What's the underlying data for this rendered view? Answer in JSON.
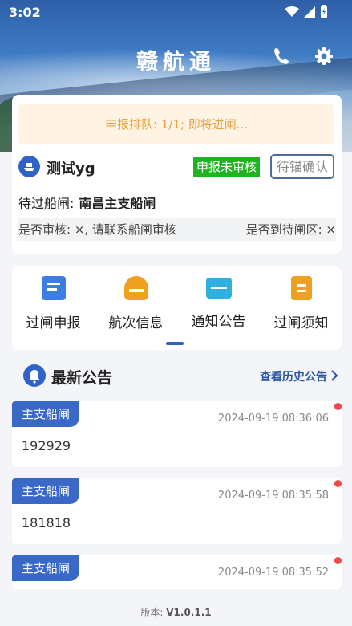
{
  "status_bar": {
    "time": "3:02"
  },
  "app": {
    "title": "赣航通"
  },
  "queue_notice": "申报排队: 1/1; 即将进闸...",
  "ship": {
    "name": "测试yg",
    "status_badge": "申报未审核",
    "anchor_badge": "待锚确认"
  },
  "lock": {
    "label": "待过船闸:",
    "value": "南昌主支船闸"
  },
  "review": {
    "left": "是否审核: ×, 请联系船闸审核",
    "right": "是否到待闸区: ×"
  },
  "menu": [
    {
      "label": "过闸申报",
      "icon": "declaration-icon",
      "color": "#3b7de0"
    },
    {
      "label": "航次信息",
      "icon": "voyage-ship-icon",
      "color": "#f0a020"
    },
    {
      "label": "通知公告",
      "icon": "notice-card-icon",
      "color": "#2eb0e0"
    },
    {
      "label": "过闸须知",
      "icon": "guide-doc-icon",
      "color": "#f0a020"
    }
  ],
  "announcements": {
    "title": "最新公告",
    "more": "查看历史公告",
    "items": [
      {
        "tag": "主支船闸",
        "date": "2024-09-19 08:36:06",
        "body": "192929"
      },
      {
        "tag": "主支船闸",
        "date": "2024-09-19 08:35:58",
        "body": "181818"
      },
      {
        "tag": "主支船闸",
        "date": "2024-09-19 08:35:52",
        "body": ""
      }
    ]
  },
  "version": {
    "label": "版本:",
    "value": "V1.0.1.1"
  },
  "colors": {
    "primary": "#2f63c8",
    "badge_green": "#1fb41f",
    "queue_text": "#e8a045",
    "unread_dot": "#f24848"
  }
}
